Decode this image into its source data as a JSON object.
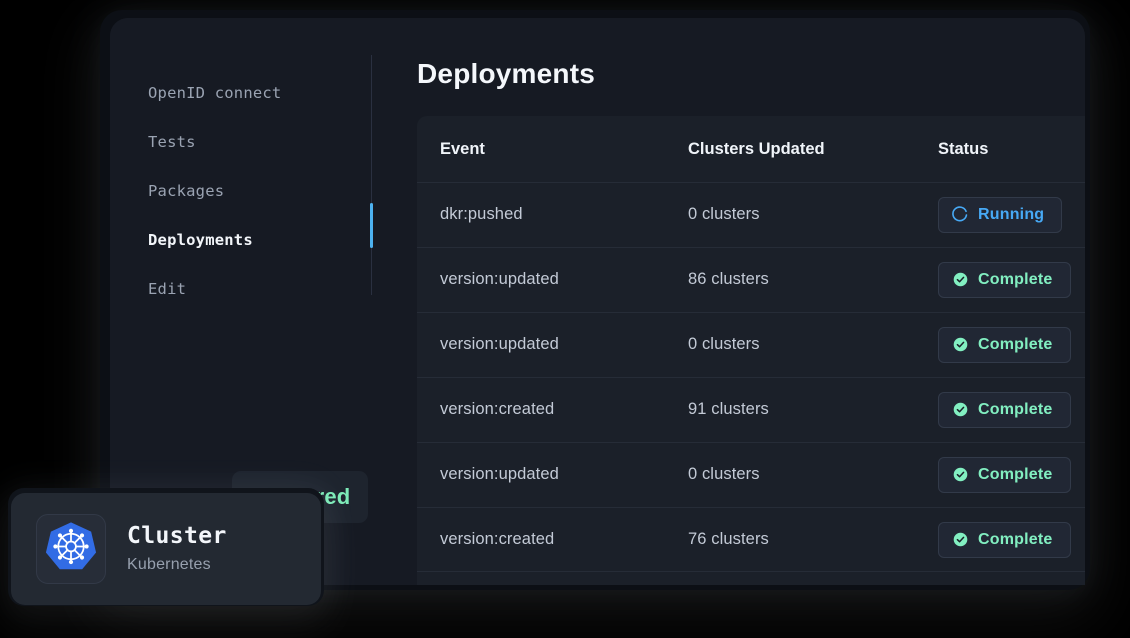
{
  "sidebar": {
    "items": [
      {
        "label": "OpenID connect",
        "active": false
      },
      {
        "label": "Tests",
        "active": false
      },
      {
        "label": "Packages",
        "active": false
      },
      {
        "label": "Deployments",
        "active": true
      },
      {
        "label": "Edit",
        "active": false
      }
    ],
    "active_indicator_color": "#4db2f0"
  },
  "main": {
    "title": "Deployments",
    "table": {
      "columns": [
        "Event",
        "Clusters Updated",
        "Status"
      ],
      "rows": [
        {
          "event": "dkr:pushed",
          "clusters": "0 clusters",
          "status": "Running",
          "status_kind": "running",
          "icon": "spinner-icon"
        },
        {
          "event": "version:updated",
          "clusters": "86 clusters",
          "status": "Complete",
          "status_kind": "complete",
          "icon": "check-circle-icon"
        },
        {
          "event": "version:updated",
          "clusters": "0 clusters",
          "status": "Complete",
          "status_kind": "complete",
          "icon": "check-circle-icon"
        },
        {
          "event": "version:created",
          "clusters": "91 clusters",
          "status": "Complete",
          "status_kind": "complete",
          "icon": "check-circle-icon"
        },
        {
          "event": "version:updated",
          "clusters": "0 clusters",
          "status": "Complete",
          "status_kind": "complete",
          "icon": "check-circle-icon"
        },
        {
          "event": "version:created",
          "clusters": "76 clusters",
          "status": "Complete",
          "status_kind": "complete",
          "icon": "check-circle-icon"
        }
      ]
    }
  },
  "overlay": {
    "delivered_chip": {
      "label": "Delivered",
      "color": "#7debb8"
    },
    "cluster_card": {
      "title": "Cluster",
      "subtitle": "Kubernetes",
      "icon": "kubernetes-icon",
      "icon_color": "#326ce5"
    }
  }
}
